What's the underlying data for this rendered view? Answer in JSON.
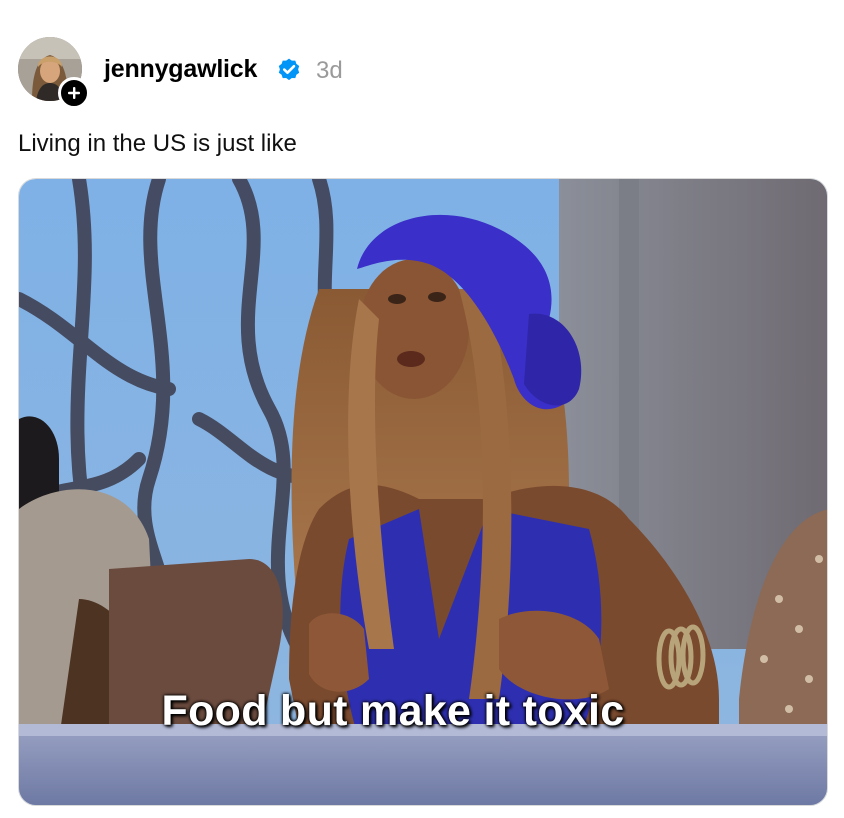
{
  "post": {
    "author": {
      "username": "jennygawlick",
      "verified": true,
      "avatar_icon": "profile-photo"
    },
    "follow_icon": "plus-icon",
    "verified_icon": "verified-badge-icon",
    "timestamp": "3d",
    "caption": "Living in the US is just like",
    "media": {
      "type": "image",
      "meme_text": "Food but make it toxic"
    }
  },
  "colors": {
    "verified_blue": "#0095f6",
    "timestamp_gray": "#9a9a9a",
    "meme_scarf_blue": "#3a2fc8"
  }
}
